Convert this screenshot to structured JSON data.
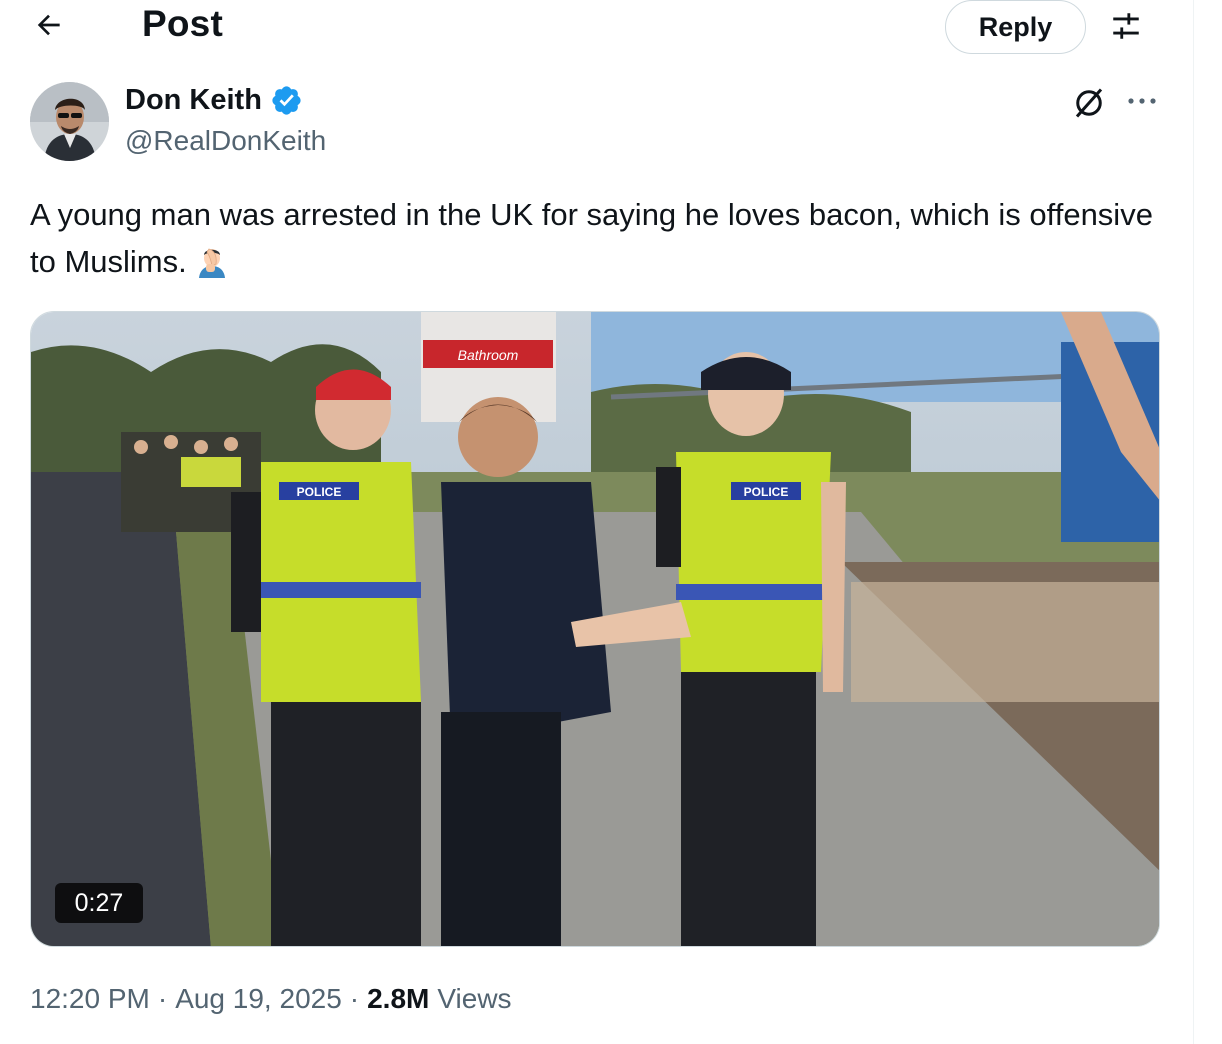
{
  "header": {
    "title": "Post",
    "reply_label": "Reply"
  },
  "author": {
    "name": "Don Keith",
    "handle": "@RealDonKeith",
    "verified": true
  },
  "tweet": {
    "text": "A young man was arrested in the UK for saying he loves bacon, which is offensive to Muslims.",
    "emoji": "man-facepalming"
  },
  "media": {
    "type": "video",
    "duration": "0:27",
    "vest_text": "POLICE",
    "sign_text": "Bathroom"
  },
  "meta": {
    "time": "12:20 PM",
    "date": "Aug 19, 2025",
    "views_count": "2.8M",
    "views_label": "Views"
  },
  "colors": {
    "verified_blue": "#1d9bf0",
    "text_primary": "#0f1419",
    "text_secondary": "#536471",
    "border": "#cfd9de"
  },
  "icons": [
    "back-arrow-icon",
    "filter-icon",
    "verified-badge-icon",
    "grok-icon",
    "more-icon"
  ]
}
